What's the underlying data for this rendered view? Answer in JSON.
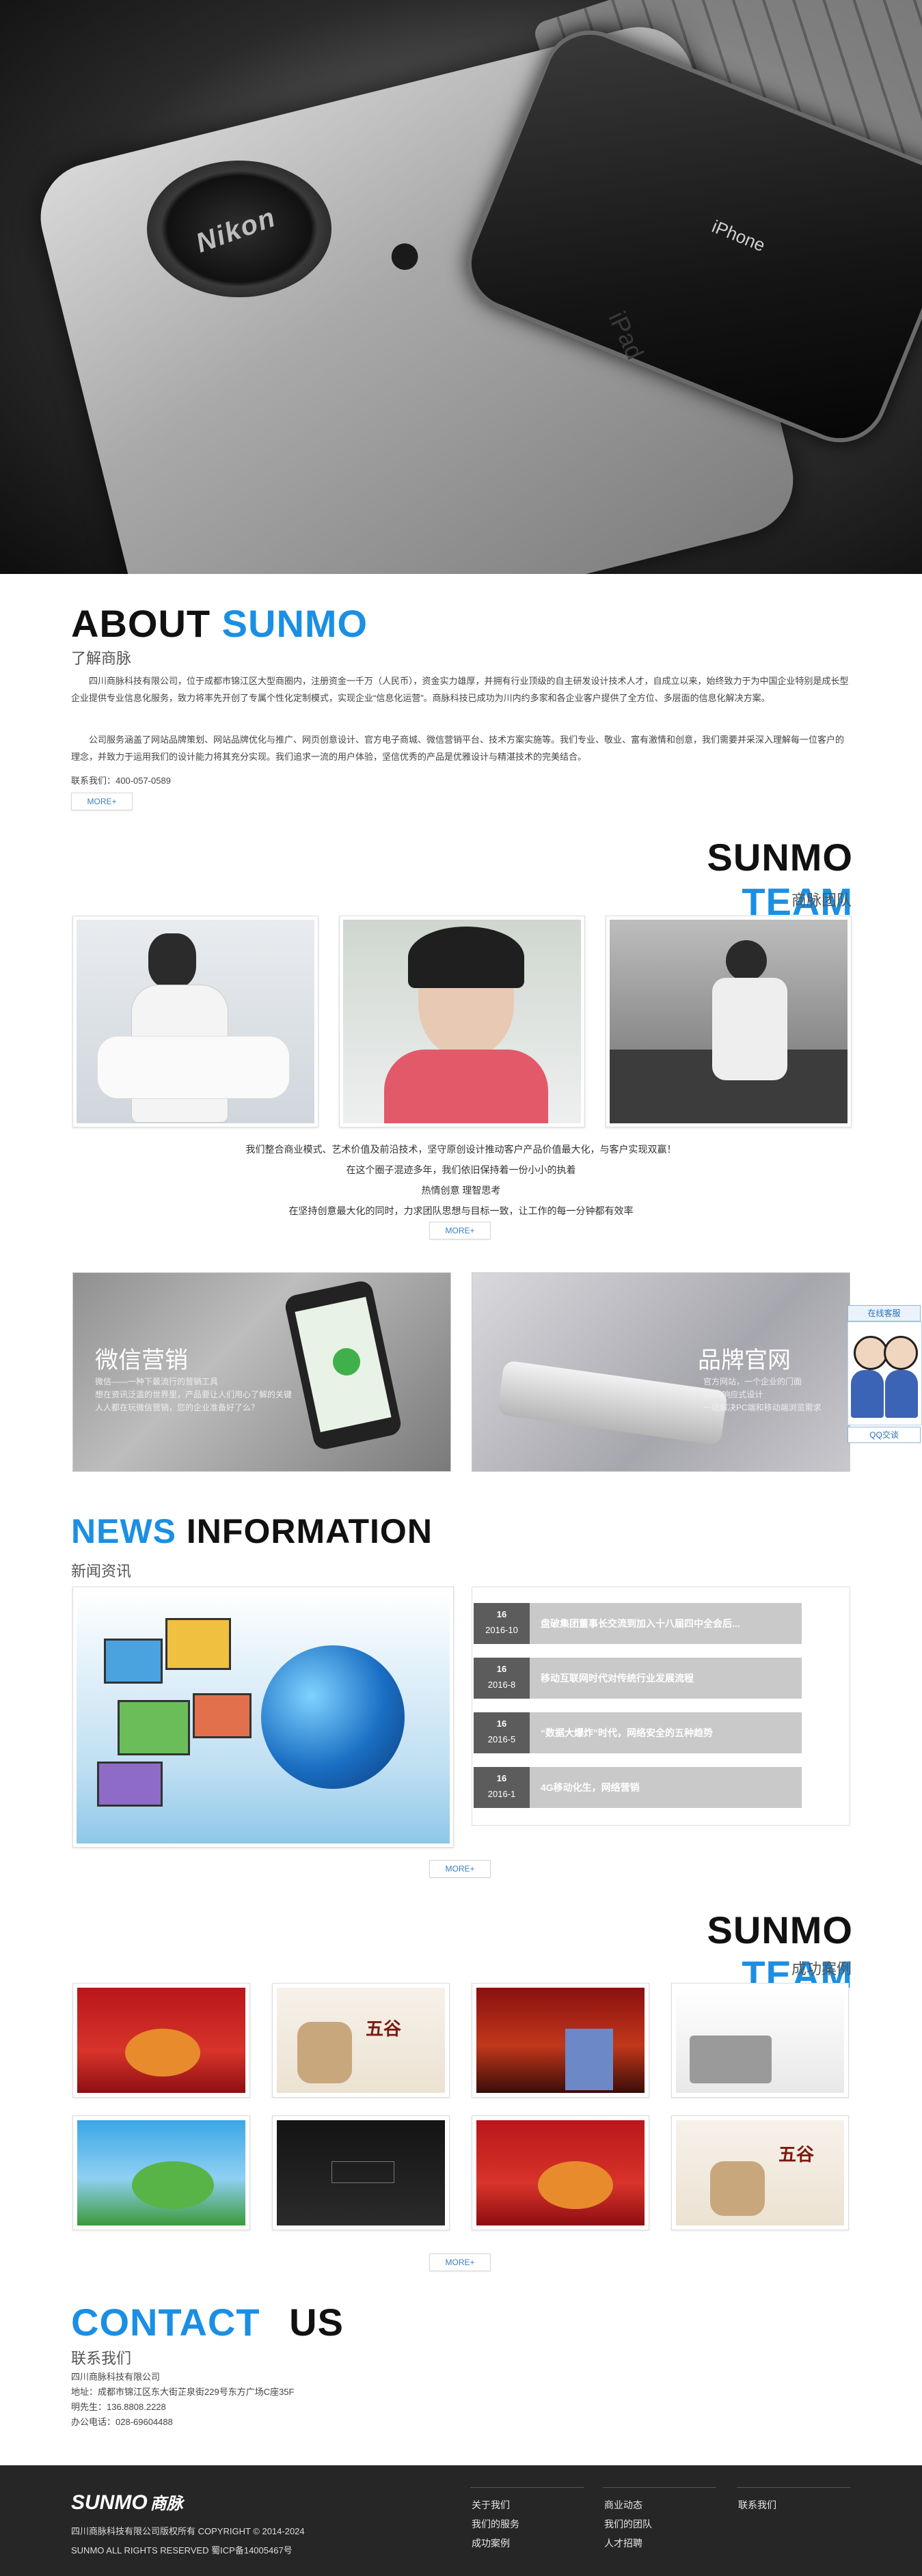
{
  "hero": {
    "lens_brand": "Nikon",
    "phone_brand": "iPhone",
    "tablet_brand": "iPad"
  },
  "about": {
    "title_black": "ABOUT",
    "title_blue": "SUNMO",
    "subtitle": "了解商脉",
    "paragraph1": "四川商脉科技有限公司，位于成都市锦江区大型商圈内，注册资金一千万（人民币），资金实力雄厚，并拥有行业顶级的自主研发设计技术人才，自成立以来，始终致力于为中国企业特别是成长型企业提供专业信息化服务，致力将率先开创了专属个性化定制模式，实现企业“信息化运营”。商脉科技已成功为川内约多家和各企业客户提供了全方位、多层面的信息化解决方案。",
    "paragraph2": "公司服务涵盖了网站品牌策划、网站品牌优化与推广、网页创意设计、官方电子商城、微信营销平台、技术方案实施等。我们专业、敬业、富有激情和创意，我们需要并采深入理解每一位客户的理念，并致力于运用我们的设计能力将其充分实现。我们追求一流的用户体验，坚信优秀的产品是优雅设计与精湛技术的完美结合。",
    "contact_label": "联系我们：",
    "contact_phone": "400-057-0589",
    "more": "MORE+"
  },
  "team": {
    "title_black": "SUNMO",
    "title_blue": "TEAM",
    "subtitle": "商脉团队",
    "lines": [
      "我们整合商业模式、艺术价值及前沿技术，坚守原创设计推动客户产品价值最大化，与客户实现双赢！",
      "在这个圈子混迹多年，我们依旧保持着一份小小的执着",
      "热情创意 理智思考",
      "在坚持创意最大化的同时，力求团队思想与目标一致，让工作的每一分钟都有效率"
    ],
    "more": "MORE+"
  },
  "promos": [
    {
      "title": "微信营销",
      "lines": [
        "微信——一种下最流行的营销工具",
        "想在资讯泛滥的世界里，产品要让人们用心了解的关键",
        "人人都在玩微信营销，您的企业准备好了么？"
      ]
    },
    {
      "title": "品牌官网",
      "lines": [
        "官方网站，一个企业的门面",
        "WEB响应式设计",
        "一站解决PC端和移动端浏览需求"
      ]
    }
  ],
  "news": {
    "title_blue": "NEWS",
    "title_black": "INFORMATION",
    "subtitle": "新闻资讯",
    "items": [
      {
        "day": "16",
        "ym": "2016-10",
        "title": "盘破集团董事长交流到加入十八届四中全会后..."
      },
      {
        "day": "16",
        "ym": "2016-8",
        "title": "移动互联网时代对传统行业发展流程"
      },
      {
        "day": "16",
        "ym": "2016-5",
        "title": "“数据大爆炸”时代，网络安全的五种趋势"
      },
      {
        "day": "16",
        "ym": "2016-1",
        "title": "4G移动化生，网络营销"
      }
    ],
    "more": "MORE+"
  },
  "cases": {
    "title_black": "SUNMO",
    "title_blue": "TEAM",
    "subtitle": "成功案例",
    "more": "MORE+"
  },
  "contact": {
    "title_blue": "CONTACT",
    "title_black": "US",
    "subtitle": "联系我们",
    "company": "四川商脉科技有限公司",
    "address": "地址：成都市锦江区东大街芷泉街229号东方广场C座35F",
    "person": "明先生：136.8808.2228",
    "office": "办公电话：028-69604488"
  },
  "footer": {
    "logo_en": "SUNMO",
    "logo_cn": "商脉",
    "copyright": "四川商脉科技有限公司版权所有 COPYRIGHT © 2014-2024",
    "rights": "SUNMO ALL RIGHTS RESERVED 蜀ICP备14005467号",
    "col1": [
      "关于我们",
      "我们的服务",
      "成功案例"
    ],
    "col2": [
      "商业动态",
      "我们的团队",
      "人才招聘"
    ],
    "col3": [
      "联系我们"
    ]
  },
  "side": {
    "online": "在线客服",
    "qq": "QQ交谈"
  }
}
